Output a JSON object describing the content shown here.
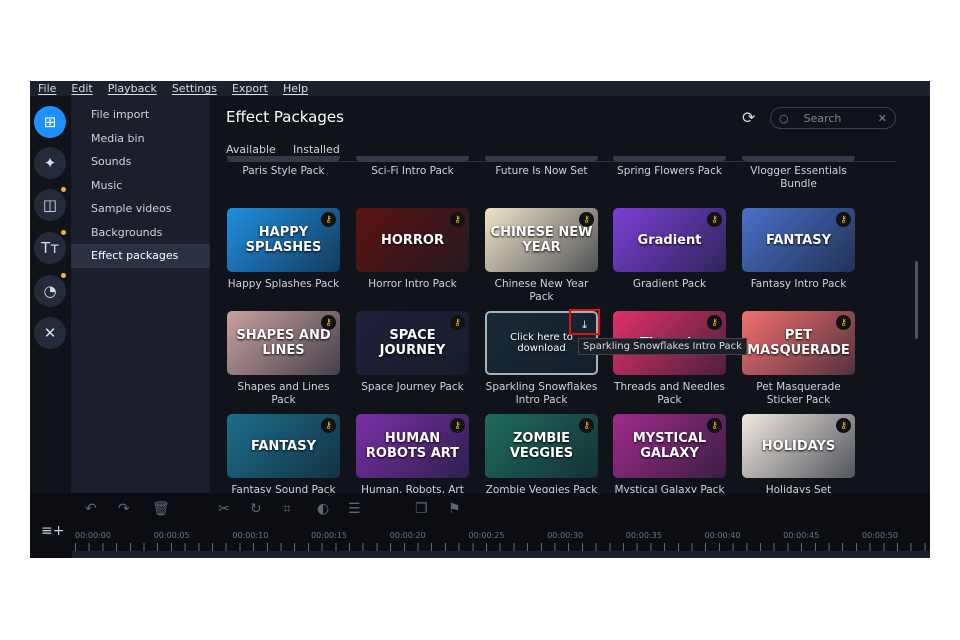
{
  "menu": [
    "File",
    "Edit",
    "Playback",
    "Settings",
    "Export",
    "Help"
  ],
  "sidebar": {
    "items": [
      "File import",
      "Media bin",
      "Sounds",
      "Music",
      "Sample videos",
      "Backgrounds",
      "Effect packages"
    ],
    "active": "Effect packages"
  },
  "main": {
    "title": "Effect Packages",
    "tabs": [
      "Available",
      "Installed"
    ],
    "search_placeholder": "Search"
  },
  "top_row": [
    "Paris Style Pack",
    "Sci-Fi Intro Pack",
    "Future Is Now Set",
    "Spring Flowers Pack",
    "Vlogger Essentials Bundle"
  ],
  "cards": [
    {
      "label": "Happy Splashes Pack",
      "thumb": "HAPPY SPLASHES",
      "bg": "#1e8fe0"
    },
    {
      "label": "Horror Intro Pack",
      "thumb": "HORROR",
      "bg": "#5a1410"
    },
    {
      "label": "Chinese New Year Pack",
      "thumb": "CHINESE NEW YEAR",
      "bg": "#f0e3c8"
    },
    {
      "label": "Gradient Pack",
      "thumb": "Gradient",
      "bg": "#7b3fd6"
    },
    {
      "label": "Fantasy Intro Pack",
      "thumb": "FANTASY",
      "bg": "#4a70c8"
    },
    {
      "label": "Shapes and Lines Pack",
      "thumb": "SHAPES AND LINES",
      "bg": "#c9a0a0"
    },
    {
      "label": "Space Journey Pack",
      "thumb": "SPACE JOURNEY",
      "bg": "#20203a"
    },
    {
      "label": "Sparkling Snowflakes Intro Pack",
      "thumb": "Click here to download",
      "bg": "#1a2a35"
    },
    {
      "label": "Threads and Needles Pack",
      "thumb": "Threads",
      "bg": "#e0306a"
    },
    {
      "label": "Pet Masquerade Sticker Pack",
      "thumb": "PET MASQUERADE",
      "bg": "#f26f6f"
    },
    {
      "label": "Fantasy Sound Pack",
      "thumb": "FANTASY",
      "bg": "#1b6e8a"
    },
    {
      "label": "Human, Robots, Art",
      "thumb": "HUMAN ROBOTS ART",
      "bg": "#7a2fa8"
    },
    {
      "label": "Zombie Veggies Pack",
      "thumb": "ZOMBIE VEGGIES",
      "bg": "#1f6b5a"
    },
    {
      "label": "Mystical Galaxy Pack",
      "thumb": "MYSTICAL GALAXY",
      "bg": "#a02a8a"
    },
    {
      "label": "Holidays Set",
      "thumb": "HOLIDAYS",
      "bg": "#f2e8e0"
    }
  ],
  "tooltip": "Sparkling Snowflakes Intro Pack",
  "timeline": {
    "ticks": [
      "00:00:00",
      "00:00:05",
      "00:00:10",
      "00:00:15",
      "00:00:20",
      "00:00:25",
      "00:00:30",
      "00:00:35",
      "00:00:40",
      "00:00:45",
      "00:00:50"
    ]
  }
}
